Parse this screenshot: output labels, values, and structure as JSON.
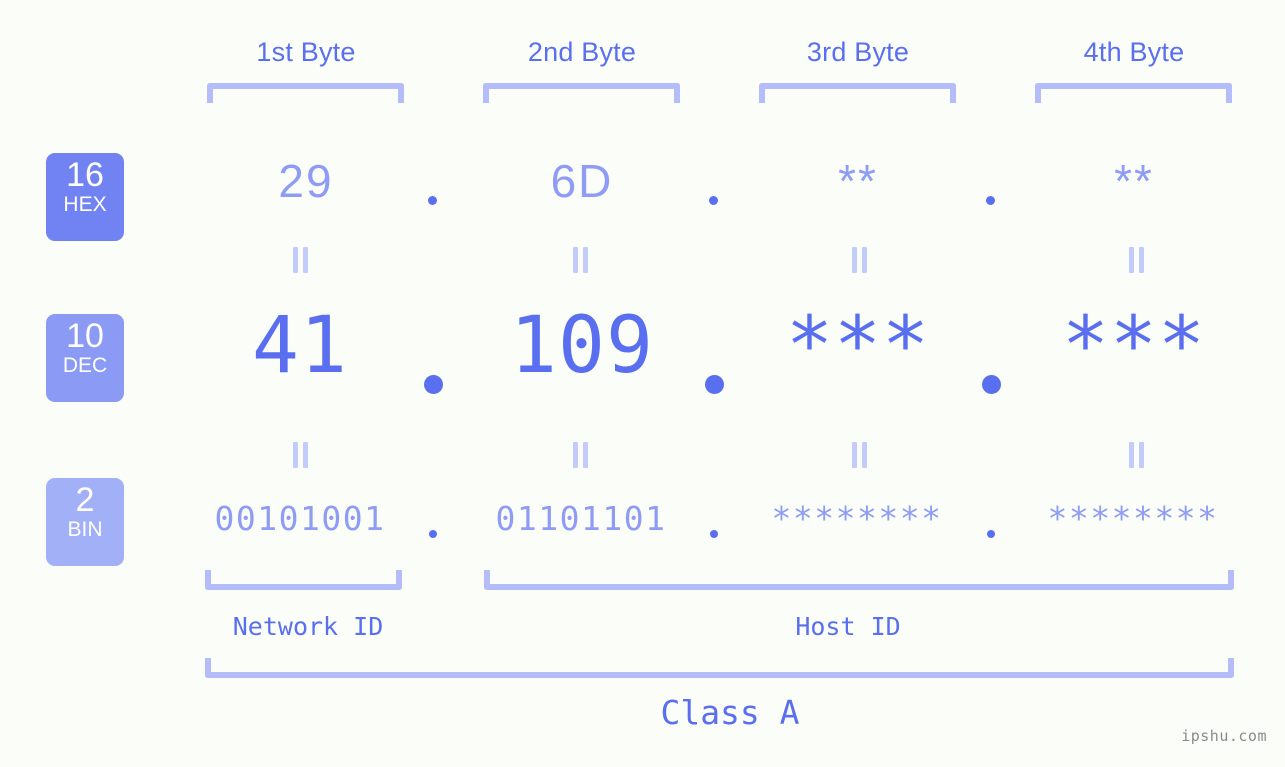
{
  "page": {
    "background_color": "#fbfdf8",
    "accent_color": "#5a6ff0",
    "accent_light_color": "#8f9cf5",
    "bracket_color": "#b4bdf9",
    "watermark": "ipshu.com"
  },
  "byte_headers": [
    {
      "label": "1st Byte"
    },
    {
      "label": "2nd Byte"
    },
    {
      "label": "3rd Byte"
    },
    {
      "label": "4th Byte"
    }
  ],
  "bases": [
    {
      "number": "16",
      "abbr": "HEX",
      "color": "#7183f2"
    },
    {
      "number": "10",
      "abbr": "DEC",
      "color": "#8b9af5"
    },
    {
      "number": "2",
      "abbr": "BIN",
      "color": "#a2b0f8"
    }
  ],
  "rows": {
    "hex": {
      "base_number": "16",
      "base_abbr": "HEX",
      "values": [
        "29",
        "6D",
        "**",
        "**"
      ],
      "separator": "."
    },
    "dec": {
      "base_number": "10",
      "base_abbr": "DEC",
      "values": [
        "41",
        "109",
        "***",
        "***"
      ],
      "separator": "."
    },
    "bin": {
      "base_number": "2",
      "base_abbr": "BIN",
      "values": [
        "00101001",
        "01101101",
        "********",
        "********"
      ],
      "separator": "."
    }
  },
  "equals_symbol": "=",
  "sections": {
    "network_id": "Network ID",
    "host_id": "Host ID",
    "class": "Class A"
  }
}
